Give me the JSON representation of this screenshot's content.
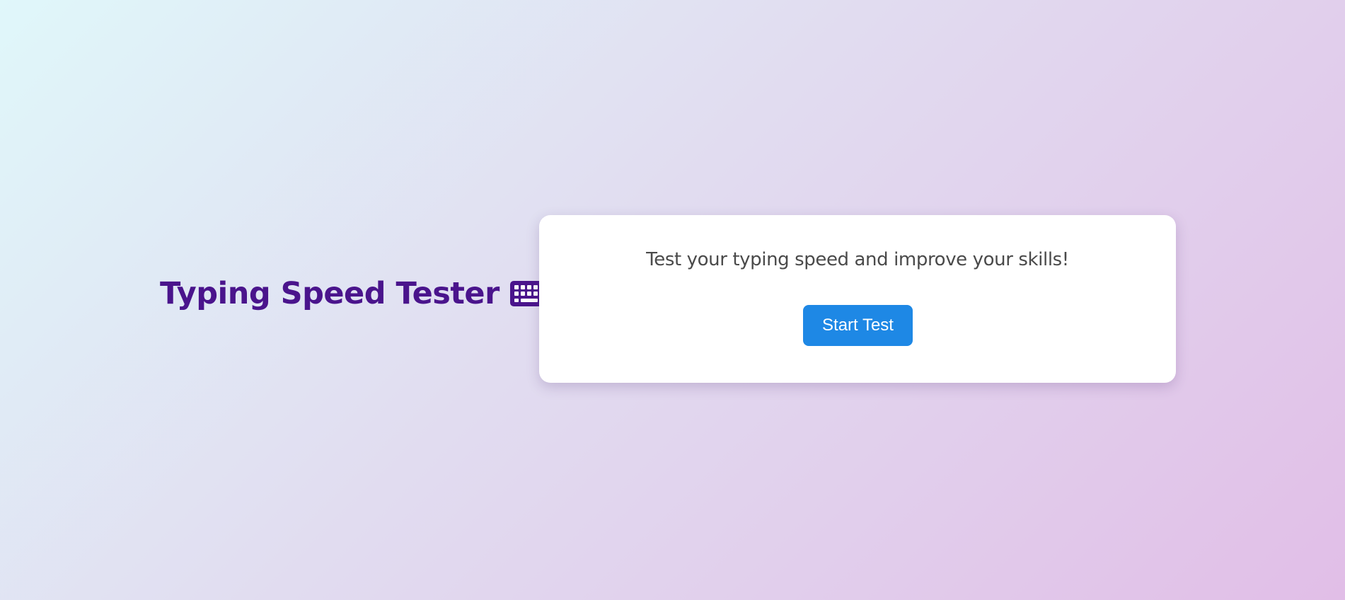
{
  "header": {
    "title": "Typing Speed Tester",
    "title_icon": "keyboard-icon",
    "title_color": "#4a148c"
  },
  "card": {
    "tagline": "Test your typing speed and improve your skills!",
    "start_button_label": "Start Test",
    "button_color": "#1e88e5"
  }
}
